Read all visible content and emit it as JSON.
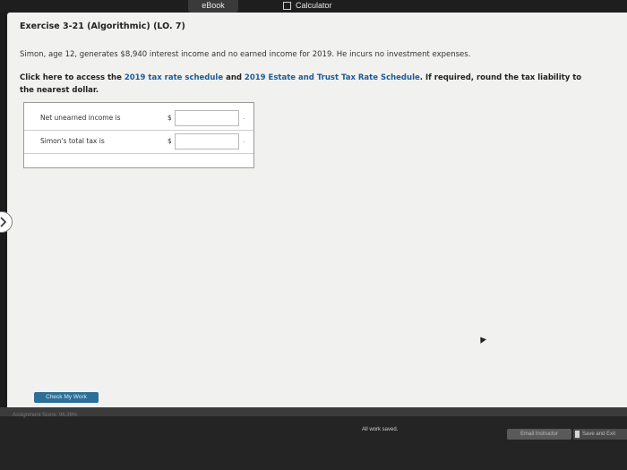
{
  "topbar": {
    "ebook_tab": "eBook",
    "calculator_tab": "Calculator"
  },
  "exercise": {
    "title": "Exercise 3-21 (Algorithmic) (LO. 7)",
    "problem": "Simon, age 12, generates $8,940 interest income and no earned income for 2019. He incurs no investment expenses.",
    "instruction_prefix": "Click here to access the ",
    "rate_schedule_link": "2019 tax rate schedule",
    "instruction_and": " and ",
    "estate_trust_link": "2019 Estate and Trust Tax Rate Schedule",
    "instruction_suffix": ". If required, round the tax liability to the nearest dollar."
  },
  "answers": {
    "rows": [
      {
        "label": "Net unearned income is",
        "currency": "$",
        "value": "",
        "suffix": "."
      },
      {
        "label": "Simon's total tax is",
        "currency": "$",
        "value": "",
        "suffix": "."
      }
    ]
  },
  "buttons": {
    "check_my_work": "Check My Work",
    "email_instructor": "Email Instructor",
    "save_and_exit": "Save and Exit"
  },
  "footer": {
    "assignment_score": "Assignment Score: 96.36%",
    "status": "All work saved."
  },
  "icons": {
    "side_chevron": "chevron-right-icon",
    "calculator": "calculator-icon",
    "save": "save-icon"
  },
  "colors": {
    "link": "#1d5a96",
    "check_button": "#2d6f97",
    "content_bg": "#f1f1ef"
  }
}
